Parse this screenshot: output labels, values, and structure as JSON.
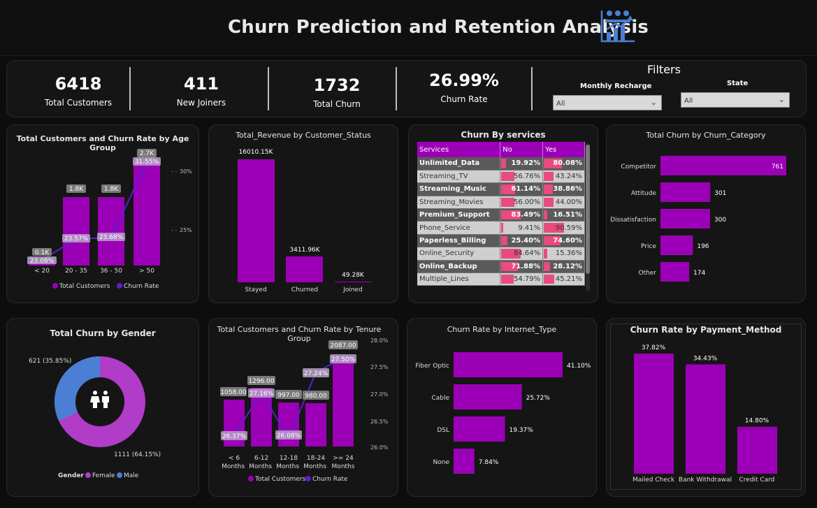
{
  "header": {
    "title": "Churn Prediction and Retention Analysis",
    "icon": "analytics-chart-icon"
  },
  "kpis": [
    {
      "value": "6418",
      "label": "Total Customers"
    },
    {
      "value": "411",
      "label": "New Joiners"
    },
    {
      "value": "1732",
      "label": "Total Churn"
    },
    {
      "value": "26.99%",
      "label": "Churn Rate"
    }
  ],
  "filters": {
    "title": "Filters",
    "monthly_recharge": {
      "label": "Monthly Recharge",
      "value": "All"
    },
    "state": {
      "label": "State",
      "value": "All"
    }
  },
  "colors": {
    "purple": "#9c00b6",
    "indigo": "#5a1fcf",
    "pink": "#e84b7d",
    "blue": "#4a7fd4",
    "violet": "#b03cc8"
  },
  "charts": {
    "age": {
      "title": "Total Customers and Churn Rate by Age Group",
      "legend": [
        "Total Customers",
        "Churn Rate"
      ],
      "right_ticks": [
        "30%",
        "25%"
      ]
    },
    "revenue": {
      "title": "Total_Revenue by Customer_Status"
    },
    "services": {
      "title": "Churn By services",
      "col_services": "Services",
      "col_no": "No",
      "col_yes": "Yes"
    },
    "category": {
      "title": "Total Churn by Churn_Category"
    },
    "gender": {
      "title": "Total Churn by Gender",
      "legend_title": "Gender",
      "legend": [
        "Female",
        "Male"
      ],
      "labels": [
        "621 (35.85%)",
        "1111 (64.15%)"
      ]
    },
    "tenure": {
      "title": "Total Customers and Churn Rate by Tenure Group",
      "legend": [
        "Total Customers",
        "Churn Rate"
      ],
      "right_ticks": [
        "28.0%",
        "27.5%",
        "27.0%",
        "26.5%",
        "26.0%"
      ]
    },
    "internet": {
      "title": "Churn Rate by Internet_Type"
    },
    "payment": {
      "title": "Churn Rate by Payment_Method"
    }
  },
  "chart_data": [
    {
      "type": "bar",
      "title": "Total Customers and Churn Rate by Age Group",
      "categories": [
        "< 20",
        "20 - 35",
        "36 - 50",
        "> 50"
      ],
      "series": [
        {
          "name": "Total Customers",
          "values": [
            0.1,
            1.8,
            1.8,
            2.7
          ],
          "labels": [
            "0.1K",
            "1.8K",
            "1.8K",
            "2.7K"
          ]
        },
        {
          "name": "Churn Rate",
          "values": [
            23.08,
            23.57,
            23.68,
            31.55
          ],
          "labels": [
            "23.08%",
            "23.57%",
            "23.68%",
            "31.55%"
          ]
        }
      ]
    },
    {
      "type": "bar",
      "title": "Total_Revenue by Customer_Status",
      "categories": [
        "Stayed",
        "Churned",
        "Joined"
      ],
      "values": [
        16010.15,
        3411.96,
        49.28
      ],
      "labels": [
        "16010.15K",
        "3411.96K",
        "49.28K"
      ]
    },
    {
      "type": "table",
      "title": "Churn By services",
      "rows": [
        {
          "service": "Unlimited_Data",
          "no": 19.92,
          "yes": 80.08,
          "no_label": "19.92%",
          "yes_label": "80.08%"
        },
        {
          "service": "Streaming_TV",
          "no": 56.76,
          "yes": 43.24,
          "no_label": "56.76%",
          "yes_label": "43.24%"
        },
        {
          "service": "Streaming_Music",
          "no": 61.14,
          "yes": 38.86,
          "no_label": "61.14%",
          "yes_label": "38.86%"
        },
        {
          "service": "Streaming_Movies",
          "no": 56.0,
          "yes": 44.0,
          "no_label": "56.00%",
          "yes_label": "44.00%"
        },
        {
          "service": "Premium_Support",
          "no": 83.49,
          "yes": 16.51,
          "no_label": "83.49%",
          "yes_label": "16.51%"
        },
        {
          "service": "Phone_Service",
          "no": 9.41,
          "yes": 90.59,
          "no_label": "9.41%",
          "yes_label": "90.59%"
        },
        {
          "service": "Paperless_Billing",
          "no": 25.4,
          "yes": 74.6,
          "no_label": "25.40%",
          "yes_label": "74.60%"
        },
        {
          "service": "Online_Security",
          "no": 84.64,
          "yes": 15.36,
          "no_label": "84.64%",
          "yes_label": "15.36%"
        },
        {
          "service": "Online_Backup",
          "no": 71.88,
          "yes": 28.12,
          "no_label": "71.88%",
          "yes_label": "28.12%"
        },
        {
          "service": "Multiple_Lines",
          "no": 54.79,
          "yes": 45.21,
          "no_label": "54.79%",
          "yes_label": "45.21%"
        }
      ]
    },
    {
      "type": "bar",
      "title": "Total Churn by Churn_Category",
      "categories": [
        "Competitor",
        "Attitude",
        "Dissatisfaction",
        "Price",
        "Other"
      ],
      "values": [
        761,
        301,
        300,
        196,
        174
      ]
    },
    {
      "type": "pie",
      "title": "Total Churn by Gender",
      "categories": [
        "Female",
        "Male"
      ],
      "values": [
        1111,
        621
      ],
      "percent": [
        64.15,
        35.85
      ]
    },
    {
      "type": "bar",
      "title": "Total Customers and Churn Rate by Tenure Group",
      "categories": [
        "< 6 Months",
        "6-12 Months",
        "12-18 Months",
        "18-24 Months",
        ">= 24 Months"
      ],
      "series": [
        {
          "name": "Total Customers",
          "values": [
            1058,
            1296,
            997,
            980,
            2087
          ],
          "labels": [
            "1058.00",
            "1296.00",
            "997.00",
            "980.00",
            "2087.00"
          ]
        },
        {
          "name": "Churn Rate",
          "values": [
            26.37,
            27.16,
            26.08,
            27.24,
            27.5
          ],
          "labels": [
            "26.37%",
            "27.16%",
            "26.08%",
            "27.24%",
            "27.50%"
          ]
        }
      ]
    },
    {
      "type": "bar",
      "title": "Churn Rate by Internet_Type",
      "categories": [
        "Fiber Optic",
        "Cable",
        "DSL",
        "None"
      ],
      "values": [
        41.1,
        25.72,
        19.37,
        7.84
      ],
      "labels": [
        "41.10%",
        "25.72%",
        "19.37%",
        "7.84%"
      ]
    },
    {
      "type": "bar",
      "title": "Churn Rate by Payment_Method",
      "categories": [
        "Mailed Check",
        "Bank Withdrawal",
        "Credit Card"
      ],
      "values": [
        37.82,
        34.43,
        14.8
      ],
      "labels": [
        "37.82%",
        "34.43%",
        "14.80%"
      ]
    }
  ]
}
